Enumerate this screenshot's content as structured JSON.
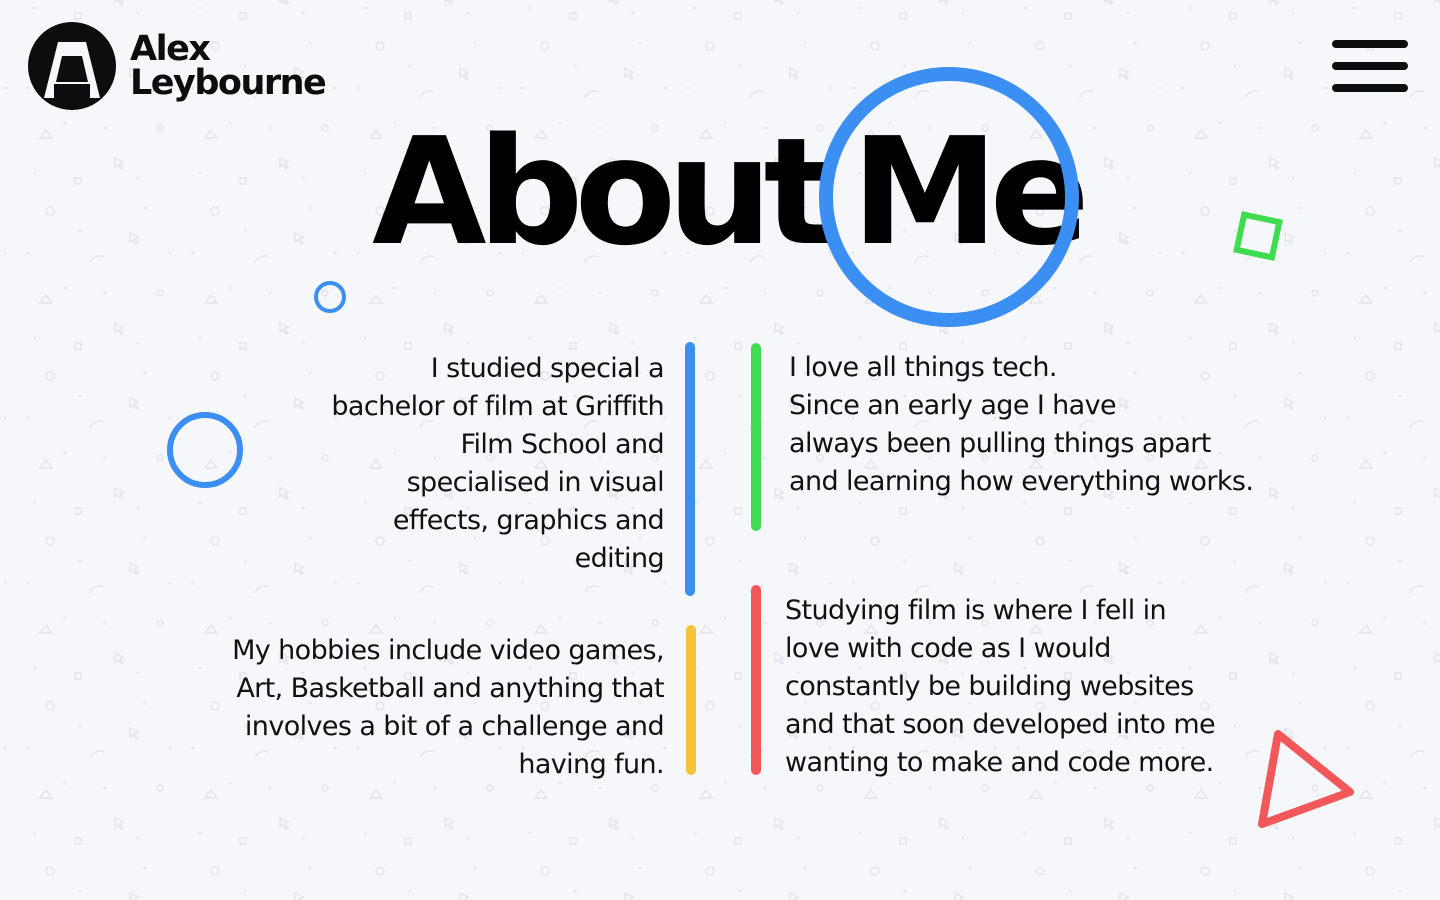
{
  "brand": {
    "name_line1": "Alex",
    "name_line2": "Leybourne",
    "logo_icon": "a-monogram-icon"
  },
  "nav": {
    "menu_icon": "hamburger-menu-icon"
  },
  "title": {
    "word1": "About",
    "word2": "Me"
  },
  "colors": {
    "blue": "#3b8ff2",
    "green": "#3fdc4f",
    "yellow": "#f5c33b",
    "red": "#f2575a",
    "text": "#111111"
  },
  "blocks": {
    "film_studies": [
      "I studied special a",
      "bachelor of film at Griffith",
      "Film School and",
      "specialised in visual",
      "effects, graphics and",
      "editing"
    ],
    "tech": [
      "I love all things tech.",
      "Since an early age I have",
      "always been pulling things apart",
      "and learning how everything works."
    ],
    "hobbies": [
      "My hobbies include video games,",
      "Art, Basketball and anything that",
      "involves a bit of a challenge and",
      "having fun."
    ],
    "code": [
      "Studying film is where I fell in",
      "love with code as I would",
      "constantly be building websites",
      "and that soon developed into me",
      "wanting to make and code more."
    ]
  }
}
